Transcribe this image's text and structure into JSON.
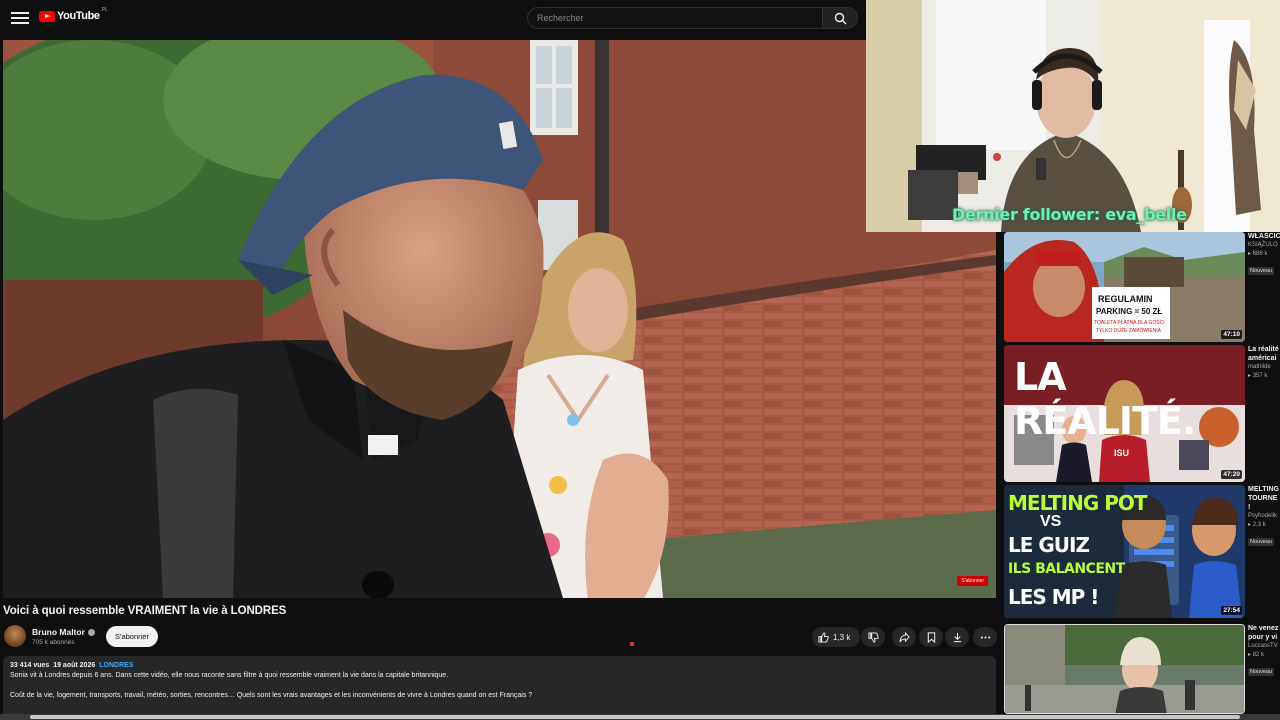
{
  "app": {
    "logo_text": "YouTube",
    "region": "PL"
  },
  "search": {
    "placeholder": "Rechercher"
  },
  "video": {
    "title": "Voici à quoi ressemble VRAIMENT la vie à LONDRES",
    "watermark": "S'abonner",
    "channel": {
      "name": "Bruno Maltor",
      "subscribers": "705 k abonnés"
    },
    "subscribe_label": "S'abonner",
    "likes": "1,3 k",
    "description": {
      "views": "33 414 vues",
      "date": "19 août 2026",
      "tag": "LONDRES",
      "line1": "Sonia vit à Londres depuis 6 ans. Dans cette vidéo, elle nous raconte sans filtre à quoi ressemble vraiment la vie dans la capitale britannique.",
      "line2": "Coût de la vie, logement, transports, travail, météo, sorties, rencontres… Quels sont les vrais avantages et les inconvénients de vivre à Londres quand on est Français ?"
    }
  },
  "overlay": {
    "follower_text": "Dernier follower: eva_belle"
  },
  "sidebar": {
    "items": [
      {
        "title": "WŁAŚCIC",
        "title2": "KSIĄŻULO",
        "meta": "686 k",
        "badge": "Nouveau",
        "duration": "47:10",
        "thumb_text": "REGULAMIN",
        "thumb_text2": "PARKING = 50 ZŁ",
        "thumb_text3": "TOALETA PŁATNA DLA GOŚCI",
        "thumb_text4": "TYLKO DUŻE ZAMÓWIENIA"
      },
      {
        "title": "La réalité",
        "title2": "américai",
        "meta": "mathilde",
        "meta2": "357 k",
        "duration": "47:20",
        "thumb_text": "LA RÉALITÉ.",
        "thumb_text2": "ISU"
      },
      {
        "title": "MELTING",
        "title2": "TOURNE",
        "title3": "!",
        "meta": "Psyhodelik",
        "meta2": "2,3 k",
        "badge": "Nouveau",
        "duration": "27:54",
        "thumb_text": "MELTING POT",
        "thumb_text2": "VS",
        "thumb_text3": "LE GUIZ",
        "thumb_text4": "ILS BALANCENT",
        "thumb_text5": "LES MP !"
      },
      {
        "title": "Ne venez",
        "title2": "pour y vi",
        "meta": "LuccassTV",
        "meta2": "82 k",
        "badge": "Nouveau"
      }
    ]
  },
  "colors": {
    "accent_red": "#ff0000",
    "link_blue": "#3ea6ff",
    "follower_green": "#6ff0b0"
  }
}
